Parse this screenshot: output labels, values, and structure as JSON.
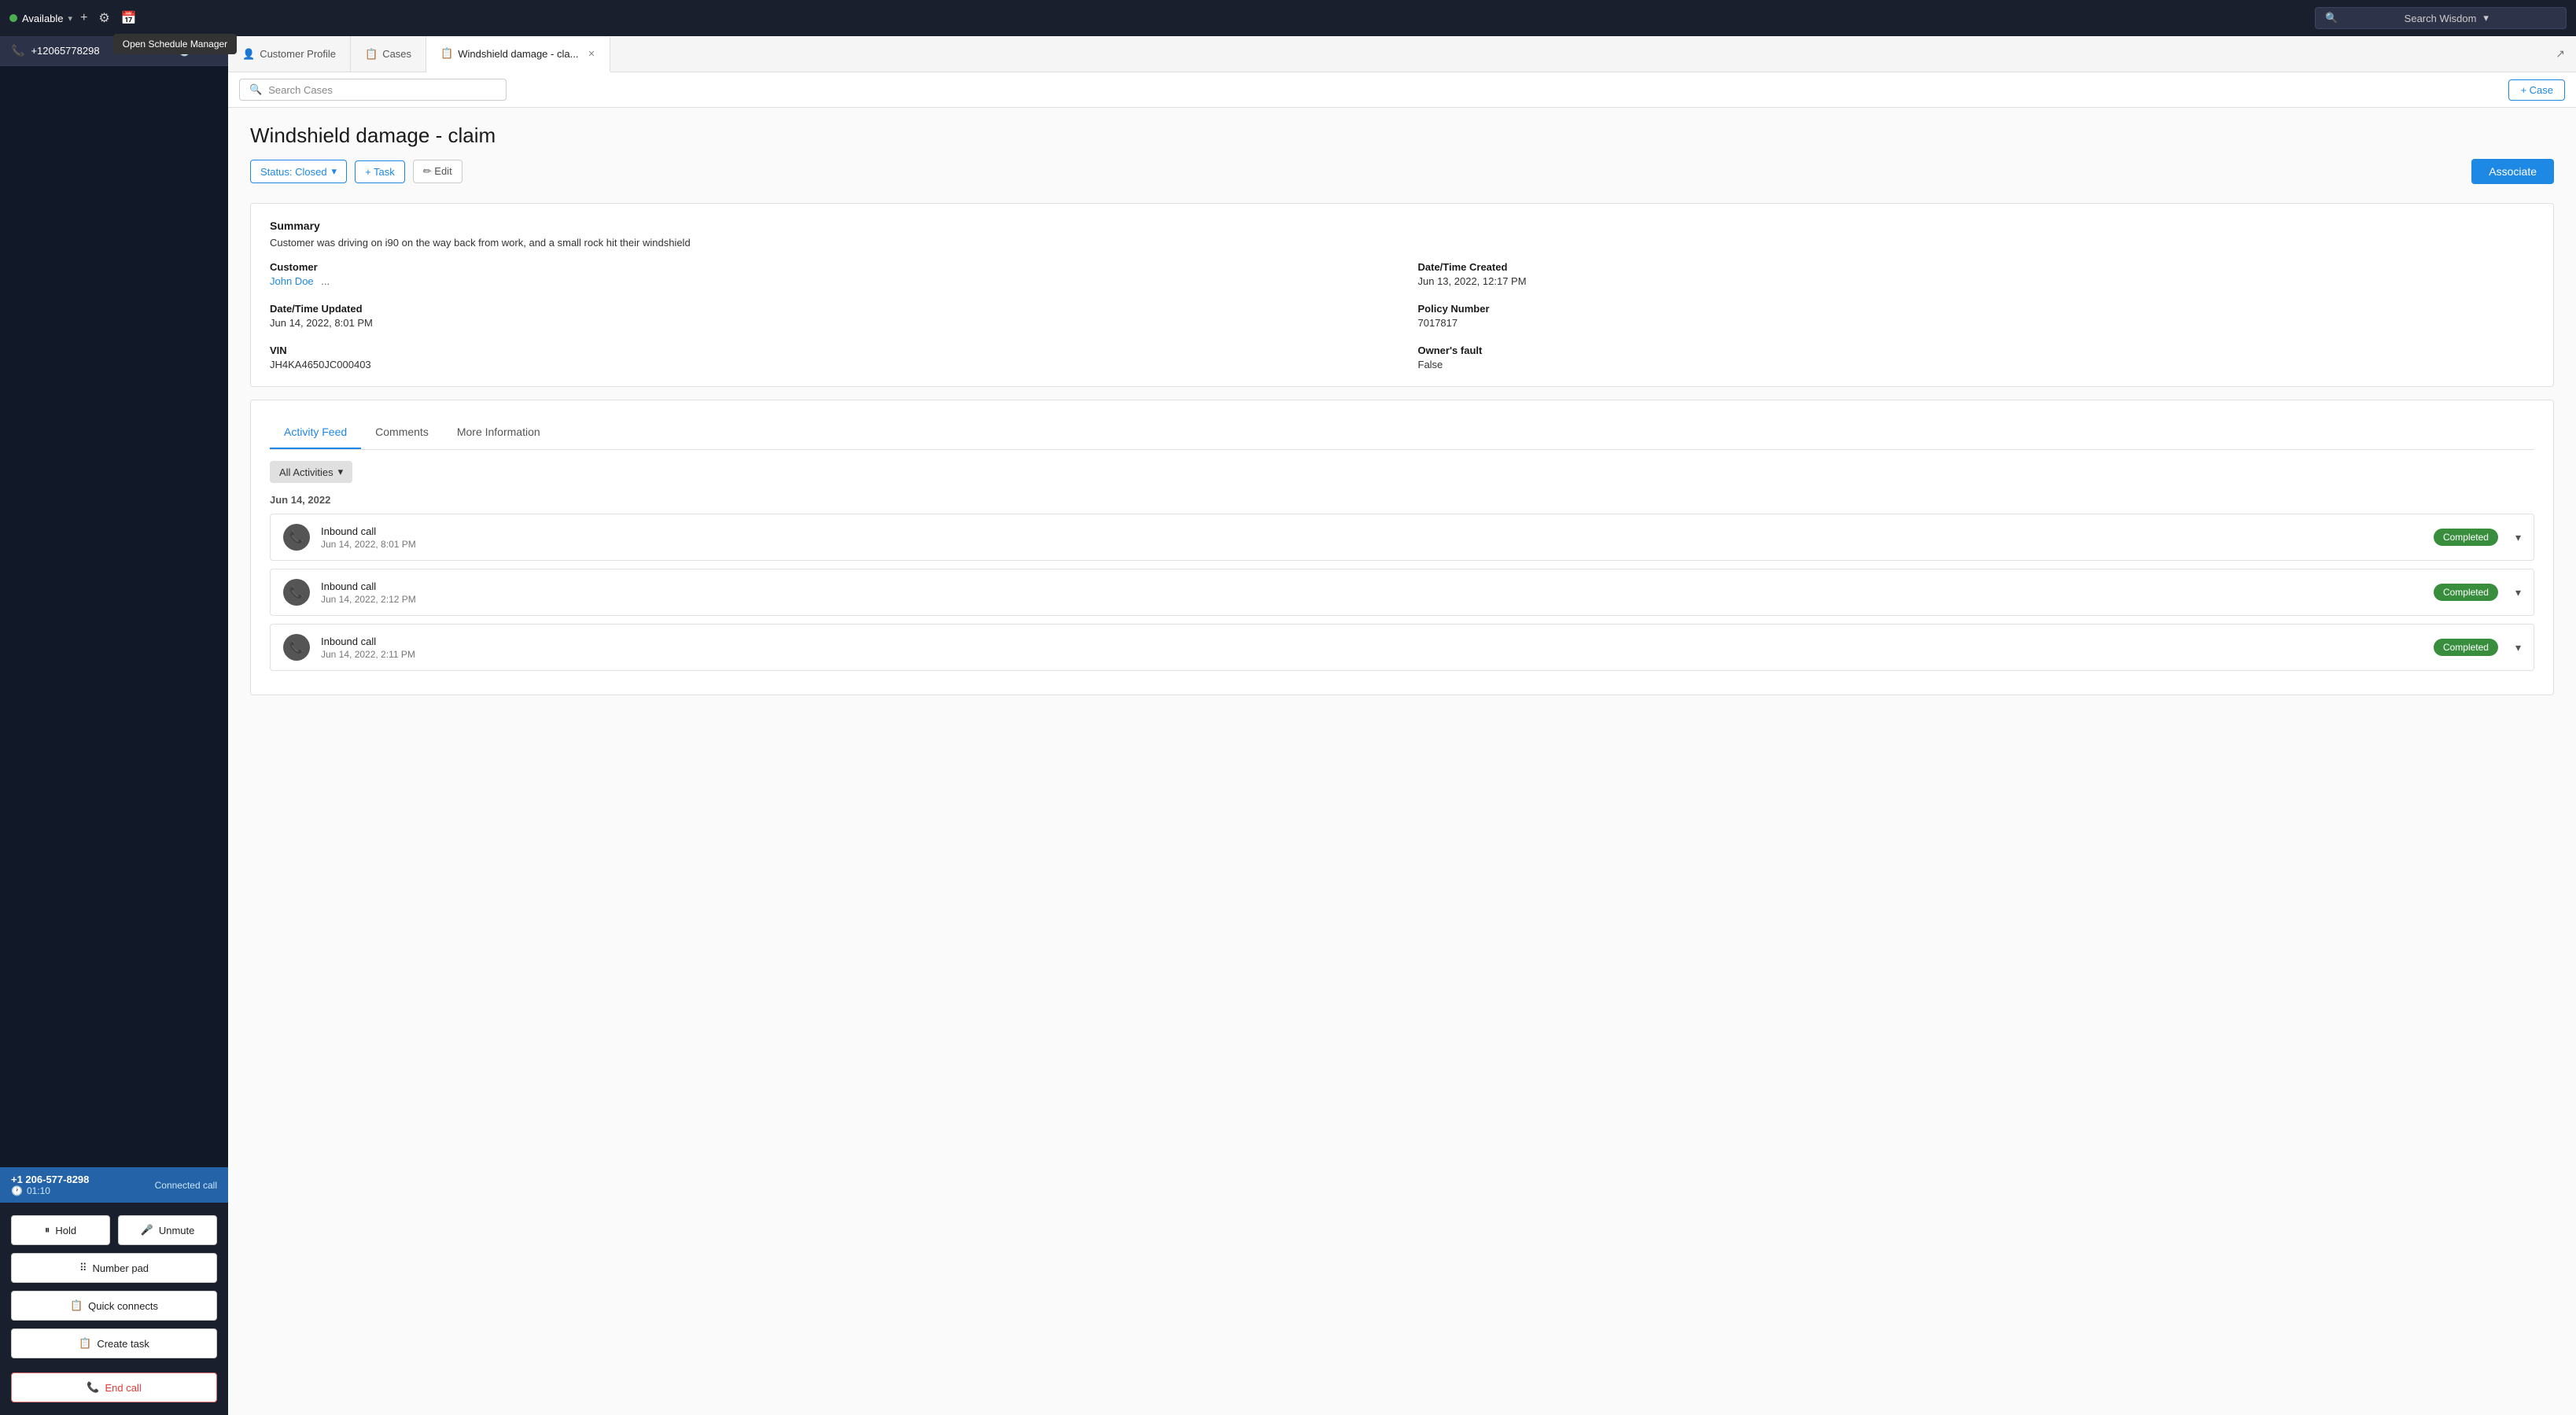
{
  "topbar": {
    "agent_status": "Available",
    "plus_icon": "+",
    "settings_icon": "⚙",
    "schedule_icon": "📅",
    "schedule_tooltip": "Open Schedule Manager",
    "wisdom_placeholder": "Search Wisdom",
    "wisdom_chevron": "▾"
  },
  "sidebar": {
    "phone_icon": "📞",
    "call_number": "+12065778298",
    "call_time_icon": "🕐",
    "call_time": "01:10",
    "caller_number": "+1 206-577-8298",
    "duration_icon": "🕐",
    "duration": "01:10",
    "connected_label": "Connected call",
    "hold_label": "Hold",
    "unmute_label": "Unmute",
    "numberpad_label": "Number pad",
    "quickconnects_label": "Quick connects",
    "createtask_label": "Create task",
    "endcall_label": "End call"
  },
  "tabs": [
    {
      "id": "customer-profile",
      "label": "Customer Profile",
      "icon": "👤",
      "active": false,
      "closeable": false
    },
    {
      "id": "cases",
      "label": "Cases",
      "icon": "📋",
      "active": false,
      "closeable": false
    },
    {
      "id": "windshield",
      "label": "Windshield damage - cla...",
      "icon": "📋",
      "active": true,
      "closeable": true
    }
  ],
  "toolbar": {
    "search_placeholder": "Search Cases",
    "add_case_label": "+ Case"
  },
  "case": {
    "title": "Windshield damage - claim",
    "status_label": "Status: Closed",
    "task_label": "+ Task",
    "edit_label": "✏ Edit",
    "associate_label": "Associate",
    "summary_label": "Summary",
    "summary_text": "Customer was driving on i90 on the way back from work, and a small rock hit their windshield",
    "customer_label": "Customer",
    "customer_value": "John Doe",
    "customer_dots": "...",
    "date_created_label": "Date/Time Created",
    "date_created_value": "Jun 13, 2022, 12:17 PM",
    "date_updated_label": "Date/Time Updated",
    "date_updated_value": "Jun 14, 2022, 8:01 PM",
    "policy_label": "Policy Number",
    "policy_value": "7017817",
    "vin_label": "VIN",
    "vin_value": "JH4KA4650JC000403",
    "fault_label": "Owner's fault",
    "fault_value": "False"
  },
  "activity": {
    "tab_feed": "Activity Feed",
    "tab_comments": "Comments",
    "tab_more": "More Information",
    "filter_label": "All Activities",
    "date_group": "Jun 14, 2022",
    "items": [
      {
        "type": "Inbound call",
        "time": "Jun 14, 2022, 8:01 PM",
        "status": "Completed"
      },
      {
        "type": "Inbound call",
        "time": "Jun 14, 2022, 2:12 PM",
        "status": "Completed"
      },
      {
        "type": "Inbound call",
        "time": "Jun 14, 2022, 2:11 PM",
        "status": "Completed"
      }
    ]
  }
}
